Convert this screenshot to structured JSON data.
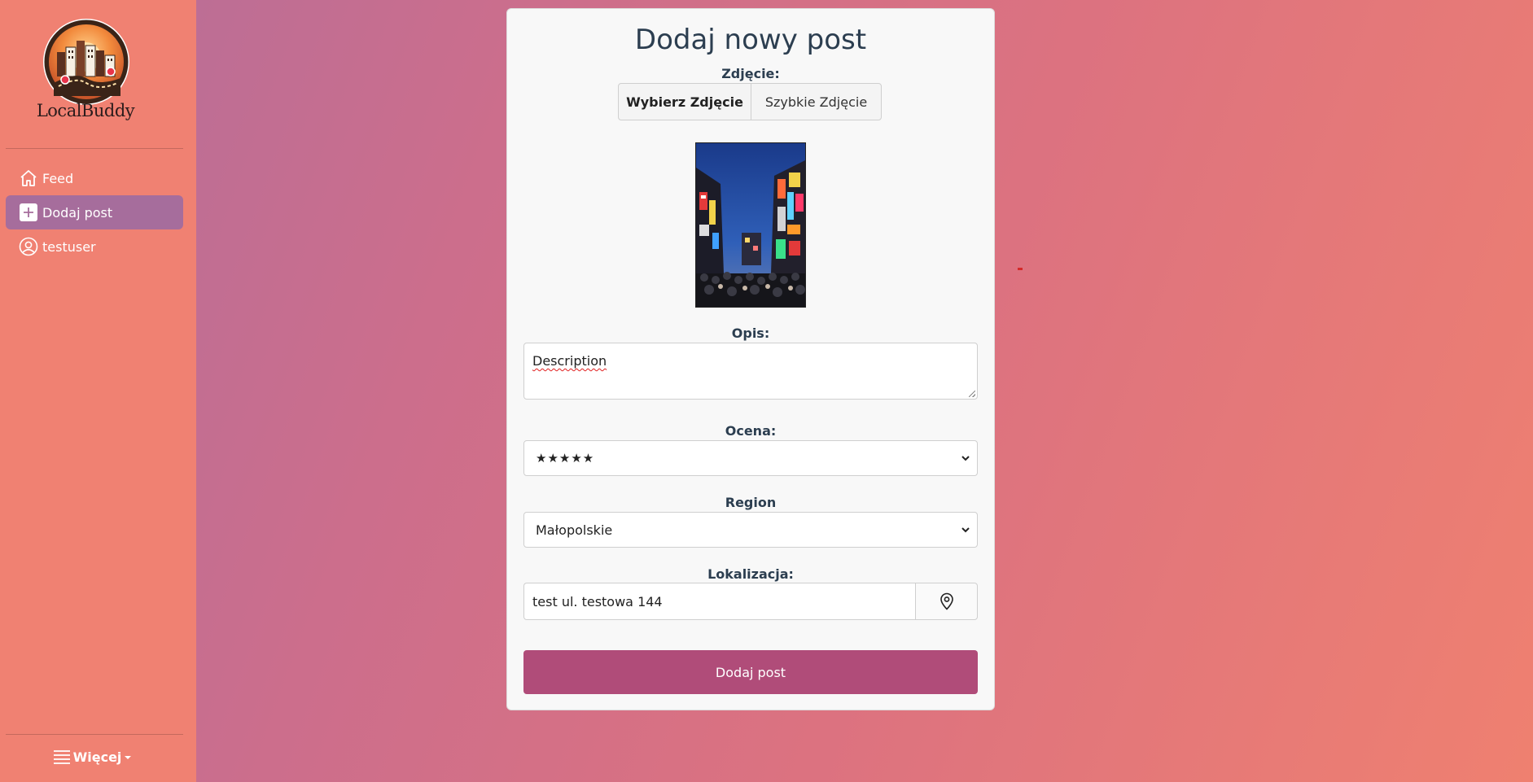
{
  "sidebar": {
    "brand": "LocalBuddy",
    "items": [
      {
        "label": "Feed",
        "icon": "home-icon"
      },
      {
        "label": "Dodaj post",
        "icon": "plus-square-icon",
        "active": true
      },
      {
        "label": "testuser",
        "icon": "user-circle-icon"
      }
    ],
    "more_label": "Więcej"
  },
  "form": {
    "title": "Dodaj nowy post",
    "photo_label": "Zdjęcie:",
    "choose_photo": "Wybierz Zdjęcie",
    "quick_photo": "Szybkie Zdjęcie",
    "description_label": "Opis:",
    "description_value": "Description",
    "rating_label": "Ocena:",
    "rating_value": "★★★★★",
    "region_label": "Region",
    "region_value": "Małopolskie",
    "location_label": "Lokalizacja:",
    "location_value": "test ul. testowa 144",
    "submit_label": "Dodaj post"
  },
  "colors": {
    "sidebar_bg": "#f08172",
    "active_item": "#a66d9c",
    "submit_bg": "#b04c79",
    "card_bg": "#f8f8f8"
  }
}
